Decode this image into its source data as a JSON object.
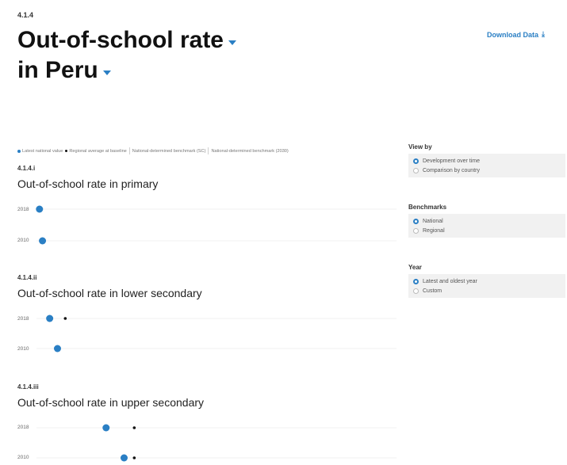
{
  "header": {
    "indicator_code": "4.1.4",
    "title_line1": "Out-of-school rate",
    "title_line2": "in Peru",
    "download_label": "Download Data",
    "download_icon": "download-icon"
  },
  "legend": {
    "items": [
      "Latest national value",
      "Regional average at baseline",
      "National-determined benchmark (SC)",
      "National-determined benchmark (2030)"
    ]
  },
  "panel": {
    "view_by": {
      "label": "View by",
      "options": [
        "Development over time",
        "Comparison by country"
      ],
      "selected": 0
    },
    "benchmarks": {
      "label": "Benchmarks",
      "options": [
        "National",
        "Regional"
      ],
      "selected": 0
    },
    "year": {
      "label": "Year",
      "options": [
        "Latest and oldest year",
        "Custom"
      ],
      "selected": 0
    }
  },
  "colors": {
    "accent": "#2a7fc4",
    "marker_regional": "#111111"
  },
  "chart_data": [
    {
      "type": "scatter",
      "code": "4.1.4.i",
      "title": "Out-of-school rate in primary",
      "categories": [
        "2018",
        "2010"
      ],
      "series": [
        {
          "name": "Latest national value",
          "values": [
            0.5,
            1.0
          ]
        }
      ]
    },
    {
      "type": "scatter",
      "code": "4.1.4.ii",
      "title": "Out-of-school rate in lower secondary",
      "categories": [
        "2018",
        "2010"
      ],
      "series": [
        {
          "name": "Latest national value",
          "values": [
            2.2,
            3.5
          ]
        },
        {
          "name": "Regional average at baseline",
          "values": [
            4.8,
            null
          ]
        }
      ]
    },
    {
      "type": "scatter",
      "code": "4.1.4.iii",
      "title": "Out-of-school rate in upper secondary",
      "categories": [
        "2018",
        "2010"
      ],
      "series": [
        {
          "name": "Latest national value",
          "values": [
            11.6,
            14.6
          ]
        },
        {
          "name": "Regional average at baseline",
          "values": [
            16.3,
            16.3
          ]
        }
      ]
    }
  ]
}
